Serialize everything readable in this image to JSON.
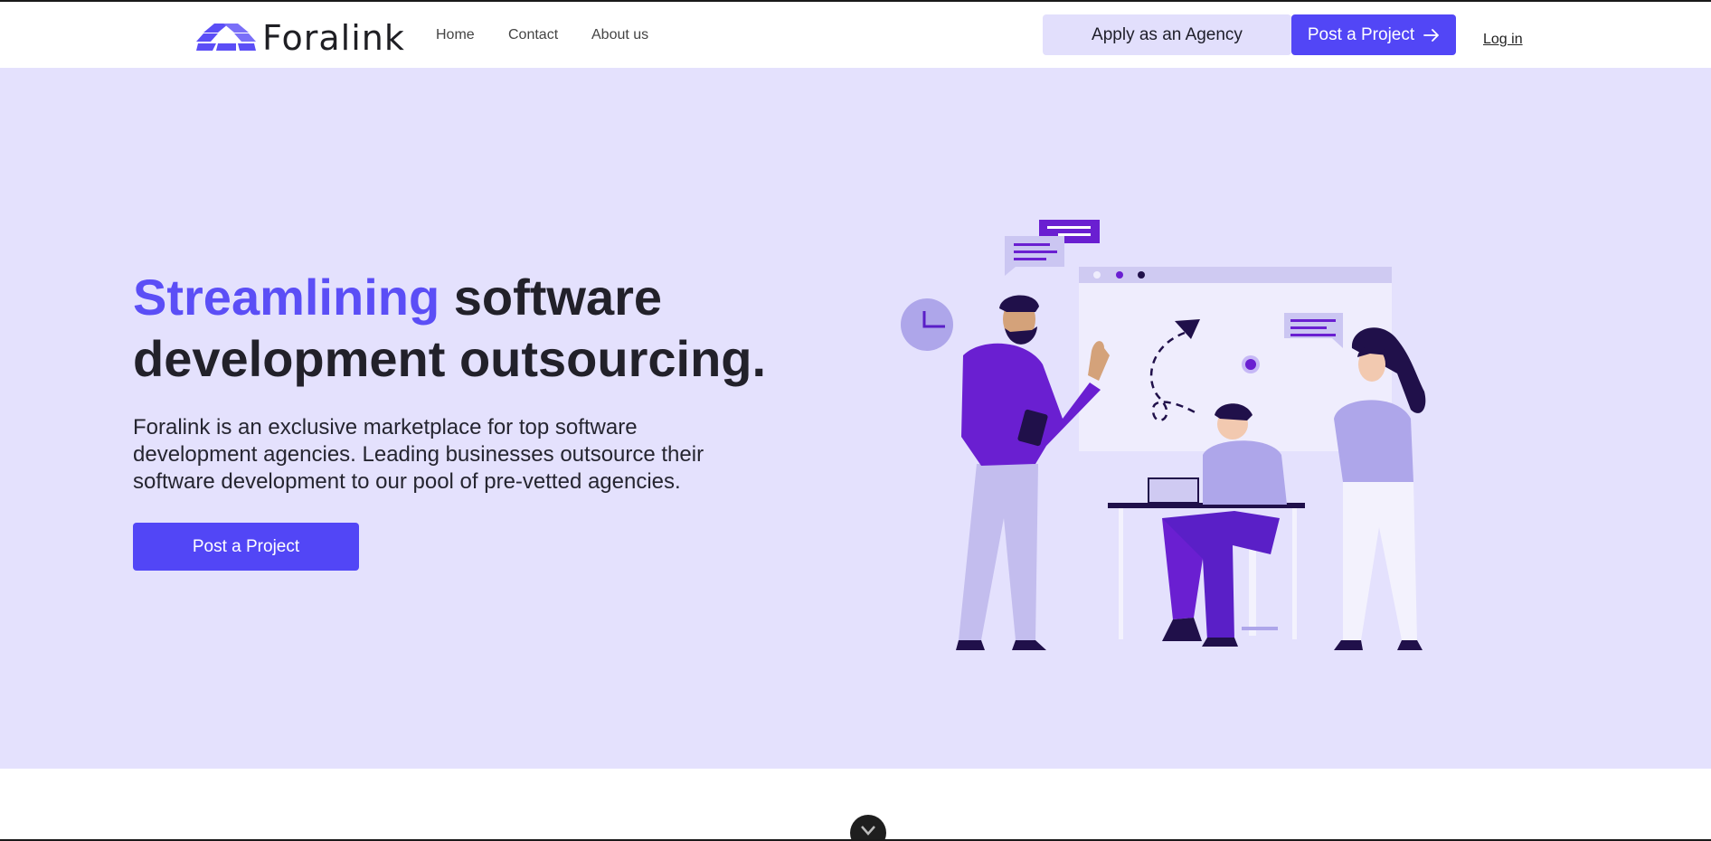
{
  "brand": {
    "name": "Foralink",
    "accent_color": "#5246f6",
    "hero_bg": "#e4e1fd"
  },
  "nav": {
    "home": "Home",
    "contact": "Contact",
    "about": "About us"
  },
  "header_actions": {
    "apply_agency": "Apply as an Agency",
    "post_project": "Post a Project",
    "post_project_icon": "arrow-right-icon",
    "login": "Log in"
  },
  "hero": {
    "headline_accent": "Streamlining",
    "headline_line1_rest": " software",
    "headline_line2": "development outsourcing.",
    "description": "Foralink is an exclusive marketplace for top software development agencies. Leading businesses outsource their software development to our pool of pre-vetted agencies.",
    "cta": "Post a Project",
    "illustration": "team-collaboration-illustration"
  },
  "scroll": {
    "icon": "chevron-down-icon"
  }
}
